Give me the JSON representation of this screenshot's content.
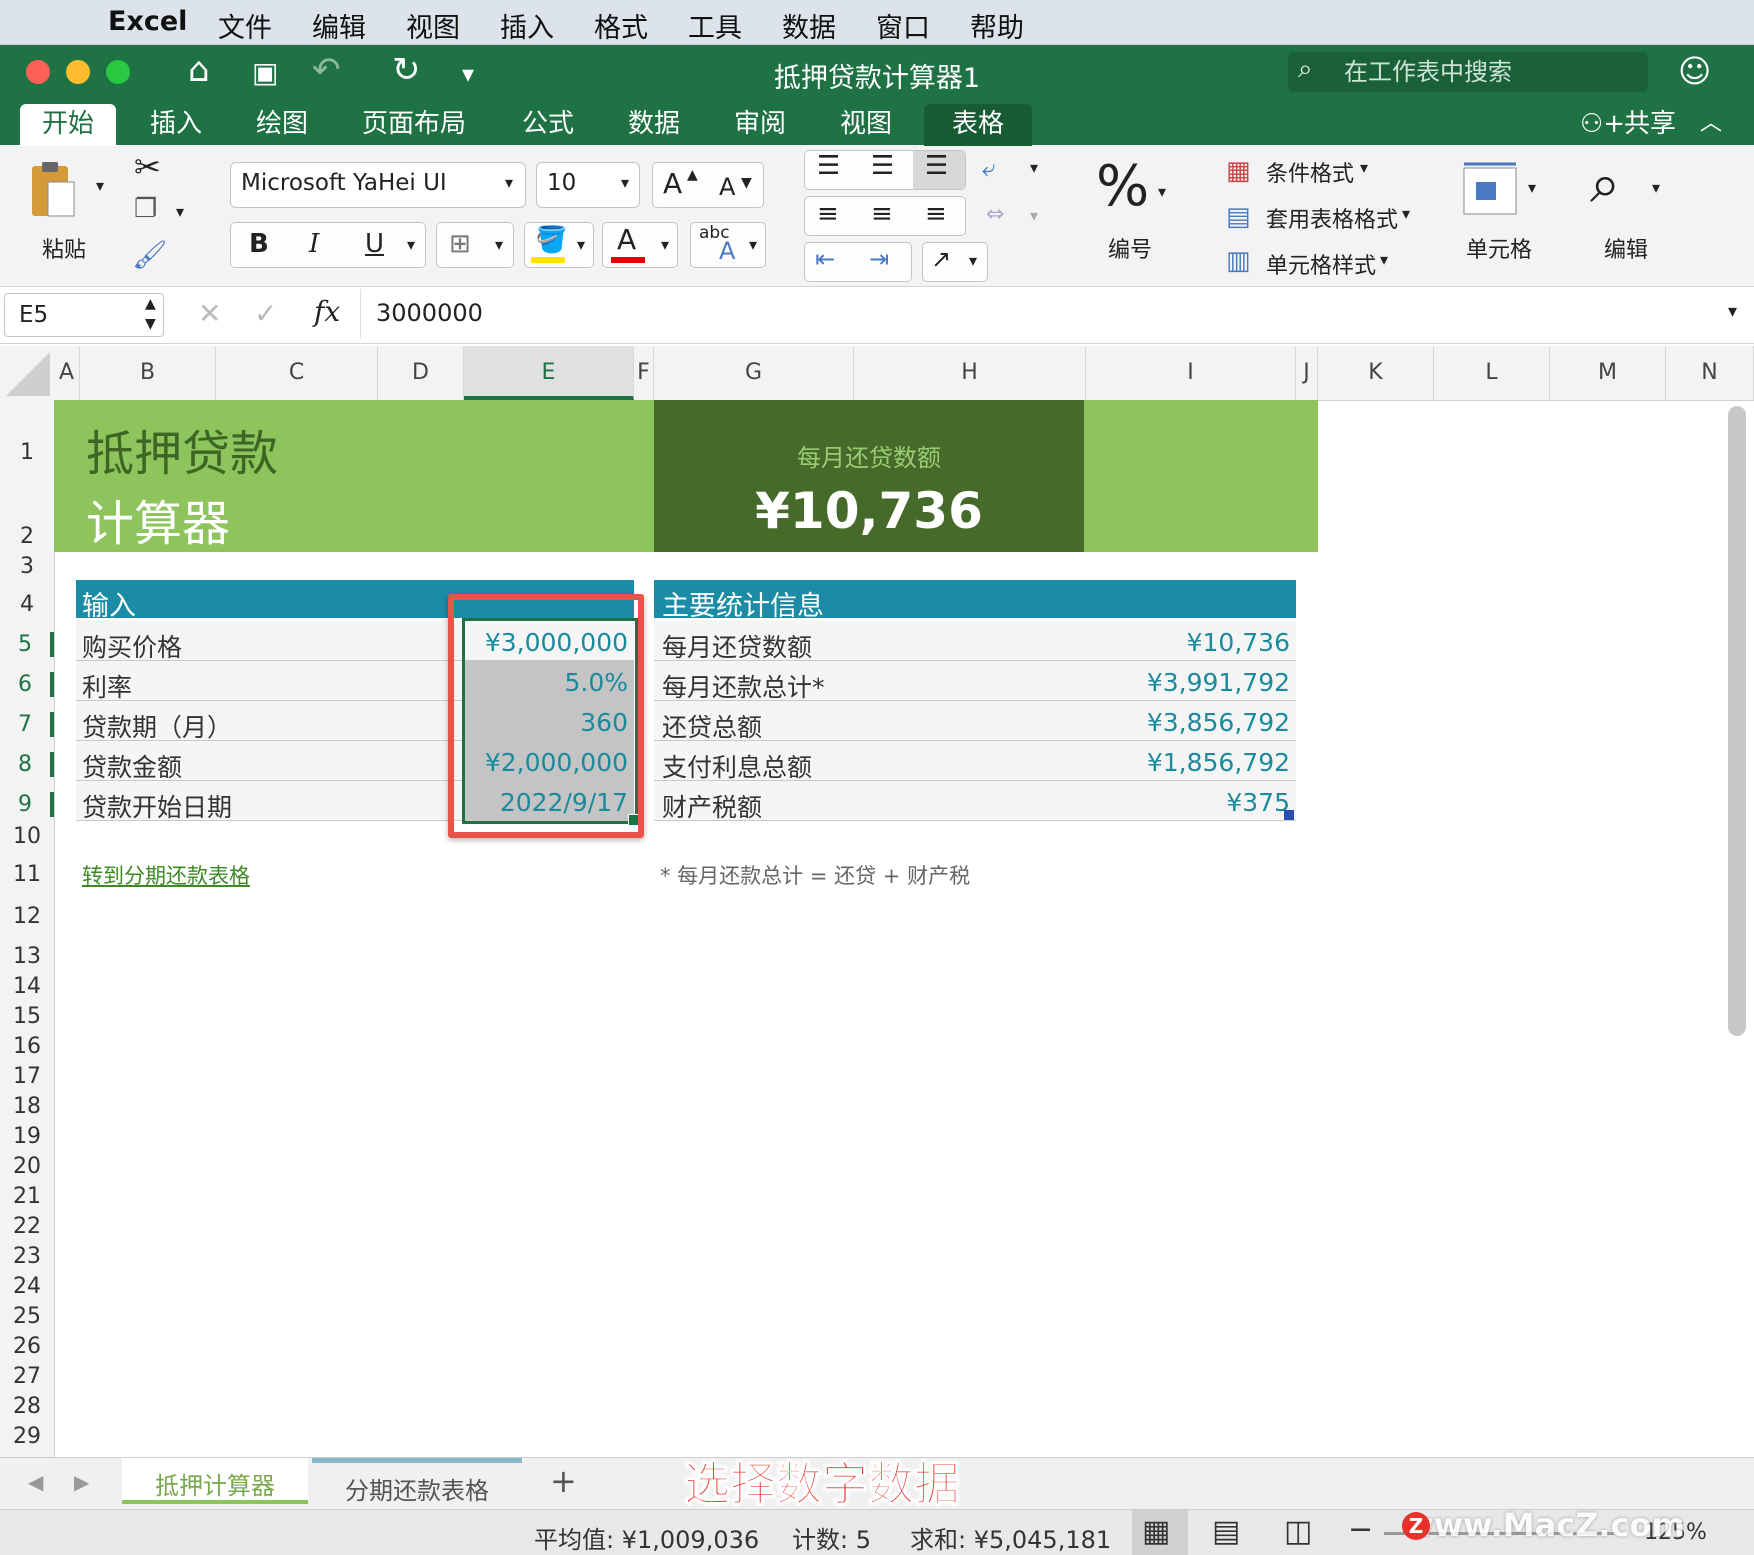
{
  "menubar": {
    "app": "Excel",
    "items": [
      "文件",
      "编辑",
      "视图",
      "插入",
      "格式",
      "工具",
      "数据",
      "窗口",
      "帮助"
    ]
  },
  "window": {
    "title": "抵押贷款计算器1",
    "search_placeholder": "在工作表中搜索",
    "share_label": "共享"
  },
  "ribbon_tabs": [
    "开始",
    "插入",
    "绘图",
    "页面布局",
    "公式",
    "数据",
    "审阅",
    "视图",
    "表格"
  ],
  "ribbon": {
    "paste_label": "粘贴",
    "font_name": "Microsoft YaHei UI",
    "font_size": "10",
    "bold": "B",
    "italic": "I",
    "underline": "U",
    "grow_font": "A",
    "shrink_font": "A",
    "font_color_letter": "A",
    "phonetic": "abc",
    "number_symbol": "%",
    "number_label": "编号",
    "conditional_format": "条件格式",
    "format_as_table": "套用表格格式",
    "cell_styles": "单元格样式",
    "cells_label": "单元格",
    "editing_label": "编辑"
  },
  "formula_bar": {
    "name_box": "E5",
    "fx": "fx",
    "value": "3000000"
  },
  "columns": [
    "A",
    "B",
    "C",
    "D",
    "E",
    "F",
    "G",
    "H",
    "I",
    "J",
    "K",
    "L",
    "M",
    "N"
  ],
  "rows": [
    "1",
    "2",
    "3",
    "4",
    "5",
    "6",
    "7",
    "8",
    "9",
    "10",
    "11",
    "12",
    "13",
    "14",
    "15",
    "16",
    "17",
    "18",
    "19",
    "20",
    "21",
    "22",
    "23",
    "24",
    "25",
    "26",
    "27",
    "28",
    "29"
  ],
  "sheet": {
    "title_line1": "抵押贷款",
    "title_line2": "计算器",
    "monthly_payment_label": "每月还贷数额",
    "monthly_payment_value": "¥10,736",
    "inputs_header": "输入",
    "inputs": [
      {
        "label": "购买价格",
        "value": "¥3,000,000"
      },
      {
        "label": "利率",
        "value": "5.0%"
      },
      {
        "label": "贷款期（月）",
        "value": "360"
      },
      {
        "label": "贷款金额",
        "value": "¥2,000,000"
      },
      {
        "label": "贷款开始日期",
        "value": "2022/9/17"
      }
    ],
    "stats_header": "主要统计信息",
    "stats": [
      {
        "label": "每月还贷数额",
        "value": "¥10,736"
      },
      {
        "label": "每月还款总计*",
        "value": "¥3,991,792"
      },
      {
        "label": "还贷总额",
        "value": "¥3,856,792"
      },
      {
        "label": "支付利息总额",
        "value": "¥1,856,792"
      },
      {
        "label": "财产税额",
        "value": "¥375"
      }
    ],
    "link_text": "转到分期还款表格",
    "footnote": "* 每月还款总计 = 还贷 + 财产税"
  },
  "sheet_tabs": [
    "抵押计算器",
    "分期还款表格"
  ],
  "add_sheet": "+",
  "caption_overlay": "选择数字数据",
  "status_bar": {
    "average": "平均值: ¥1,009,036",
    "count": "计数: 5",
    "sum": "求和: ¥5,045,181",
    "zoom": "125%",
    "watermark": "www.MacZ.com"
  },
  "colors": {
    "excel_green": "#1f7244",
    "title_green": "#8dc45c",
    "dark_green": "#456a2a",
    "header_teal": "#1b8ba6",
    "value_teal": "#1a8a9e",
    "highlight_red": "#e8534a"
  }
}
